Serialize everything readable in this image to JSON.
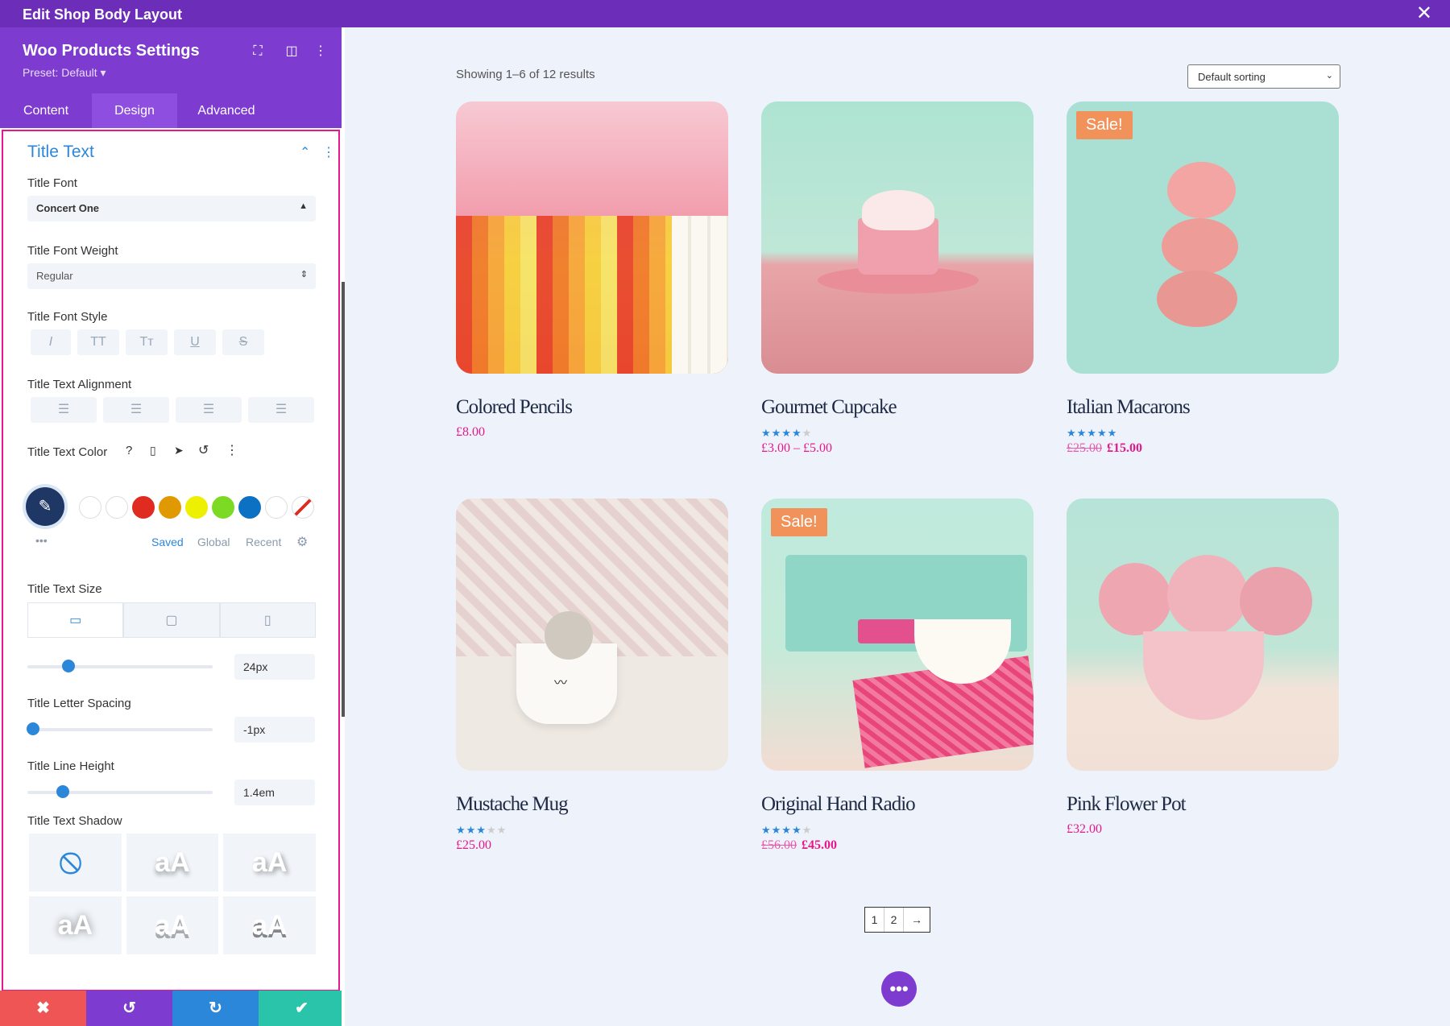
{
  "topbar": {
    "title": "Edit Shop Body Layout",
    "close_icon": "close-icon"
  },
  "panel": {
    "title": "Woo Products Settings",
    "preset": "Preset: Default ▾",
    "tabs": [
      "Content",
      "Design",
      "Advanced"
    ],
    "active_tab": "Design",
    "section_title": "Title Text",
    "title_font": {
      "label": "Title Font",
      "value": "Concert One"
    },
    "title_font_weight": {
      "label": "Title Font Weight",
      "value": "Regular"
    },
    "title_font_style": {
      "label": "Title Font Style",
      "buttons": [
        "I",
        "TT",
        "Tт",
        "U",
        "S"
      ]
    },
    "title_text_alignment": {
      "label": "Title Text Alignment",
      "icons": [
        "align-left-icon",
        "align-center-icon",
        "align-right-icon",
        "align-justify-icon"
      ]
    },
    "title_text_color": {
      "label": "Title Text Color",
      "swatches": [
        "#ffffff",
        "#ffffff",
        "#e02b20",
        "#e09900",
        "#edf000",
        "#7cda24",
        "#0c71c3",
        "#ffffff"
      ],
      "picker_color": "#1f3765",
      "tabs": [
        "Saved",
        "Global",
        "Recent"
      ],
      "active_tab": "Saved"
    },
    "title_text_size": {
      "label": "Title Text Size",
      "value": "24px",
      "slider_fraction": 0.22
    },
    "title_letter_spacing": {
      "label": "Title Letter Spacing",
      "value": "-1px",
      "slider_fraction": 0.03
    },
    "title_line_height": {
      "label": "Title Line Height",
      "value": "1.4em",
      "slider_fraction": 0.19
    },
    "title_text_shadow": {
      "label": "Title Text Shadow",
      "none_icon": "no-shadow-icon",
      "sample": "aA"
    },
    "bottom_bar": {
      "discard": "✖",
      "undo": "↺",
      "redo": "↻",
      "save": "✔",
      "colors": [
        "#ef5555",
        "#7e3bd0",
        "#2b87da",
        "#29c4a9"
      ]
    }
  },
  "shop": {
    "results_text": "Showing 1–6 of 12 results",
    "sorting": "Default sorting",
    "products": [
      {
        "name": "Colored Pencils",
        "price": "£8.00",
        "old_price": "",
        "rating": 0,
        "sale": false,
        "sale_label": ""
      },
      {
        "name": "Gourmet Cupcake",
        "price": "£3.00 – £5.00",
        "old_price": "",
        "rating": 4,
        "sale": false,
        "sale_label": ""
      },
      {
        "name": "Italian Macarons",
        "price": "£15.00",
        "old_price": "£25.00",
        "rating": 5,
        "sale": true,
        "sale_label": "Sale!"
      },
      {
        "name": "Mustache Mug",
        "price": "£25.00",
        "old_price": "",
        "rating": 3,
        "sale": false,
        "sale_label": ""
      },
      {
        "name": "Original Hand Radio",
        "price": "£45.00",
        "old_price": "£56.00",
        "rating": 4,
        "sale": true,
        "sale_label": "Sale!"
      },
      {
        "name": "Pink Flower Pot",
        "price": "£32.00",
        "old_price": "",
        "rating": 0,
        "sale": false,
        "sale_label": ""
      }
    ],
    "pagination": [
      "1",
      "2",
      "→"
    ],
    "fab_label": "•••"
  }
}
